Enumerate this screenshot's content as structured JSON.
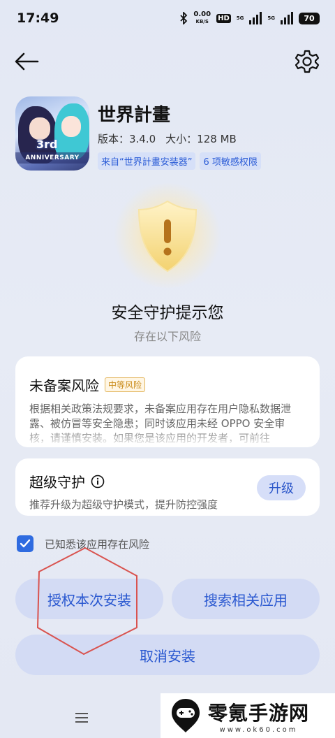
{
  "status_bar": {
    "time": "17:49",
    "net_speed_value": "0.00",
    "net_speed_unit": "KB/S",
    "hd_label": "HD",
    "signal_label_1": "5G",
    "signal_label_2": "5G",
    "battery": "70"
  },
  "nav": {
    "back_icon": "arrow-left-icon",
    "settings_icon": "gear-icon"
  },
  "app": {
    "name": "世界計畫",
    "version": "版本：3.4.0",
    "size": "大小：128 MB",
    "tags": [
      "来自“世界計畫安装器”",
      "6 项敏感权限"
    ],
    "icon_caption": "ANNIVERSARY",
    "icon_caption_top": "3rd"
  },
  "protection": {
    "headline": "安全守护提示您",
    "subline": "存在以下风险",
    "shield_color": "#f5d77a"
  },
  "risk_card": {
    "title": "未备案风险",
    "badge": "中等风险",
    "body": "根据相关政策法规要求，未备案应用存在用户隐私数据泄露、被仿冒等安全隐患；同时该应用未经 OPPO 安全审核，请谨慎安装。如果您是该应用的开发者，可前往"
  },
  "guard_card": {
    "title": "超级守护",
    "subtitle": "推荐升级为超级守护模式，提升防控强度",
    "upgrade_label": "升级"
  },
  "acknowledge": {
    "label": "已知悉该应用存在风险",
    "checked": true
  },
  "buttons": {
    "authorize": "授权本次安装",
    "search": "搜索相关应用",
    "cancel": "取消安装"
  },
  "watermark": {
    "title": "零氪手游网",
    "url": "www.ok60.com"
  },
  "colors": {
    "accent": "#2f6be0",
    "button_bg": "#d3dbf4",
    "annotation_red": "#d9534f"
  }
}
